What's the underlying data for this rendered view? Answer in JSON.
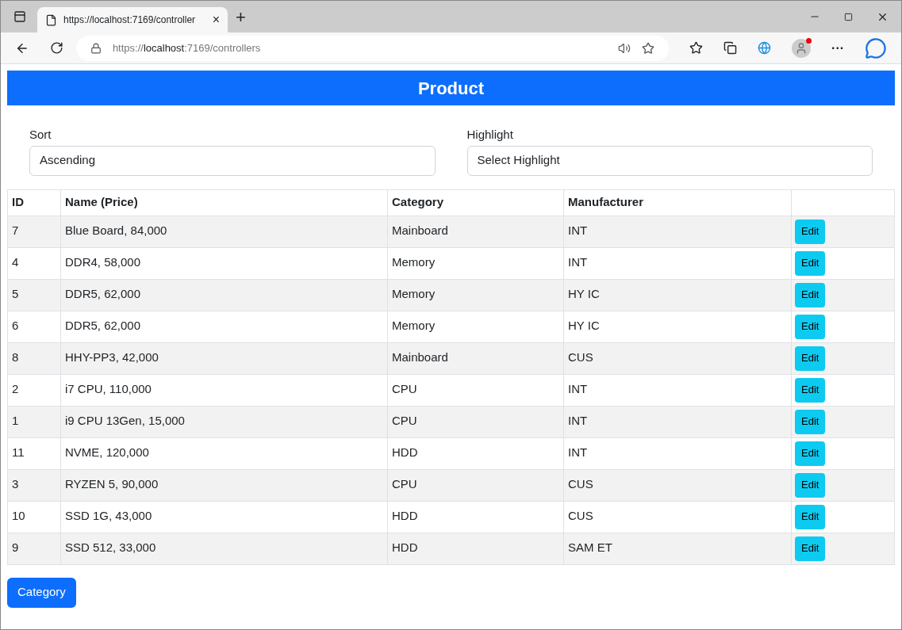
{
  "browser": {
    "tab": {
      "title": "https://localhost:7169/controller",
      "close": "×"
    },
    "new_tab": "+",
    "address": {
      "scheme": "https://",
      "host": "localhost",
      "rest": ":7169/controllers"
    },
    "more": "···"
  },
  "header": {
    "title": "Product"
  },
  "filters": [
    {
      "label": "Sort",
      "value": "Ascending"
    },
    {
      "label": "Highlight",
      "value": "Select Highlight"
    }
  ],
  "table": {
    "columns": [
      "ID",
      "Name (Price)",
      "Category",
      "Manufacturer"
    ],
    "rows": [
      {
        "id": "7",
        "name": "Blue Board, 84,000",
        "category": "Mainboard",
        "manufacturer": "INT",
        "action": "Edit"
      },
      {
        "id": "4",
        "name": "DDR4, 58,000",
        "category": "Memory",
        "manufacturer": "INT",
        "action": "Edit"
      },
      {
        "id": "5",
        "name": "DDR5, 62,000",
        "category": "Memory",
        "manufacturer": "HY IC",
        "action": "Edit"
      },
      {
        "id": "6",
        "name": "DDR5, 62,000",
        "category": "Memory",
        "manufacturer": "HY IC",
        "action": "Edit"
      },
      {
        "id": "8",
        "name": "HHY-PP3, 42,000",
        "category": "Mainboard",
        "manufacturer": "CUS",
        "action": "Edit"
      },
      {
        "id": "2",
        "name": "i7 CPU, 110,000",
        "category": "CPU",
        "manufacturer": "INT",
        "action": "Edit"
      },
      {
        "id": "1",
        "name": "i9 CPU 13Gen, 15,000",
        "category": "CPU",
        "manufacturer": "INT",
        "action": "Edit"
      },
      {
        "id": "11",
        "name": "NVME, 120,000",
        "category": "HDD",
        "manufacturer": "INT",
        "action": "Edit"
      },
      {
        "id": "3",
        "name": "RYZEN 5, 90,000",
        "category": "CPU",
        "manufacturer": "CUS",
        "action": "Edit"
      },
      {
        "id": "10",
        "name": "SSD 1G, 43,000",
        "category": "HDD",
        "manufacturer": "CUS",
        "action": "Edit"
      },
      {
        "id": "9",
        "name": "SSD 512, 33,000",
        "category": "HDD",
        "manufacturer": "SAM ET",
        "action": "Edit"
      }
    ]
  },
  "footer_button": "Category"
}
